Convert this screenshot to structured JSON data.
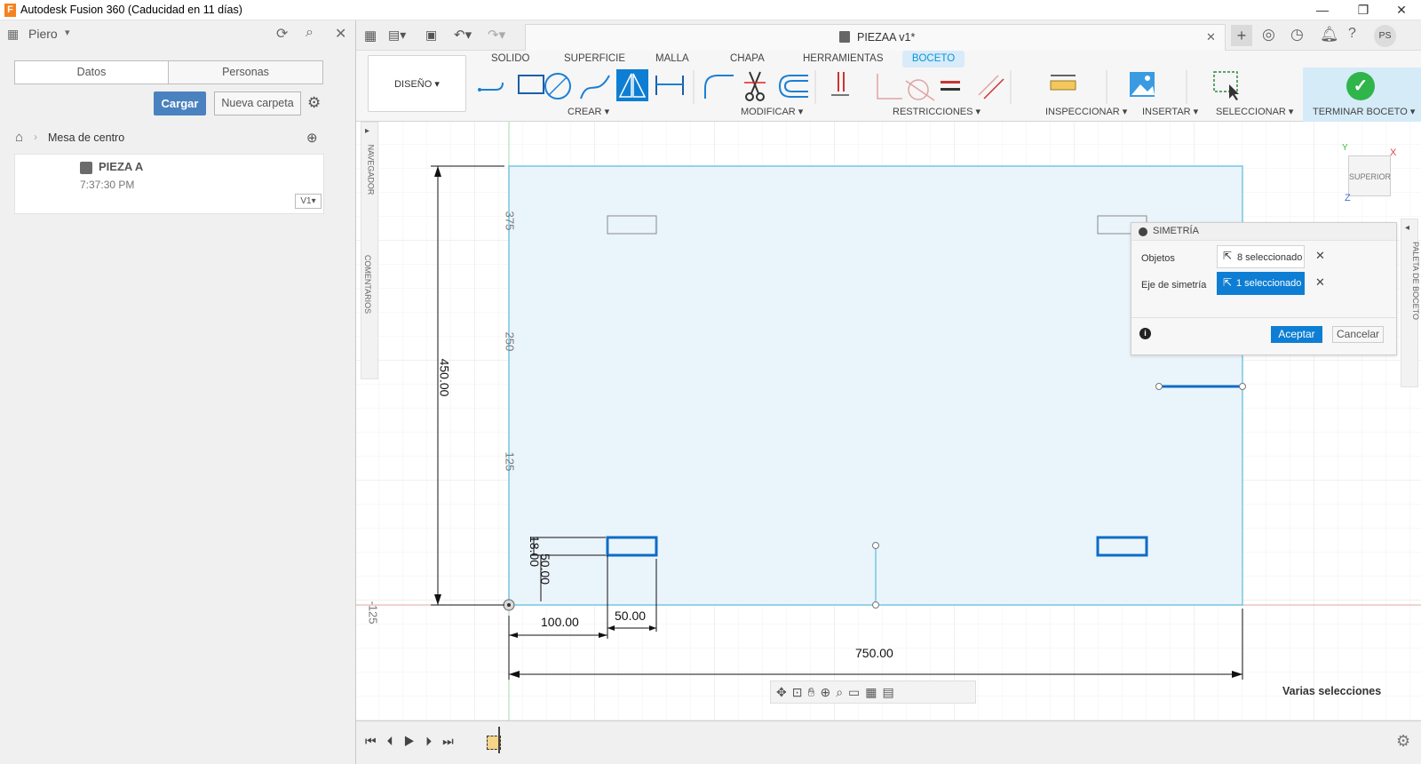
{
  "window": {
    "title": "Autodesk Fusion 360 (Caducidad en 11 días)",
    "app_letter": "F",
    "controls": {
      "minimize": "—",
      "maximize": "❐",
      "close": "✕"
    }
  },
  "left_panel": {
    "user": "Piero",
    "tabs": [
      "Datos",
      "Personas"
    ],
    "upload_button": "Cargar",
    "new_folder_button": "Nueva carpeta",
    "breadcrumb": "Mesa de centro",
    "file": {
      "name": "PIEZA A",
      "time": "7:37:30 PM",
      "version": "V1"
    }
  },
  "document": {
    "title": "PIEZAA v1*",
    "user_initials": "PS"
  },
  "ribbon": {
    "workspace": "DISEÑO",
    "tabs": [
      "SOLIDO",
      "SUPERFICIE",
      "MALLA",
      "CHAPA",
      "HERRAMIENTAS",
      "BOCETO"
    ],
    "active_tab": "BOCETO",
    "groups": [
      "CREAR",
      "MODIFICAR",
      "RESTRICCIONES",
      "INSPECCIONAR",
      "INSERTAR",
      "SELECCIONAR",
      "TERMINAR BOCETO"
    ]
  },
  "side_labels": {
    "navigator": "NAVEGADOR",
    "comments": "COMENTARIOS",
    "palette": "PALETA DE BOCETO"
  },
  "viewcube": {
    "face": "SUPERIOR",
    "axis_x": "X",
    "axis_y": "Y",
    "axis_z": "Z"
  },
  "dialog": {
    "title": "SIMETRÍA",
    "objects_label": "Objetos",
    "objects_value": "8 seleccionado",
    "axis_label": "Eje de simetría",
    "axis_value": "1 seleccionado",
    "ok": "Aceptar",
    "cancel": "Cancelar"
  },
  "sketch": {
    "ruler": [
      "375",
      "250",
      "125",
      "-125"
    ],
    "dimensions": {
      "height": "450.00",
      "width": "750.00",
      "offset_x": "100.00",
      "rect_width": "50.00",
      "rect_height": "18.00",
      "offset_y": "50.00"
    }
  },
  "status": {
    "selection": "Varias selecciones"
  },
  "colors": {
    "accent": "#0696d7",
    "sketch_fill": "#eaf4fb",
    "sketch_line": "#76c6e0",
    "selected": "#0d6cc7",
    "finish_green": "#2fb54a"
  }
}
